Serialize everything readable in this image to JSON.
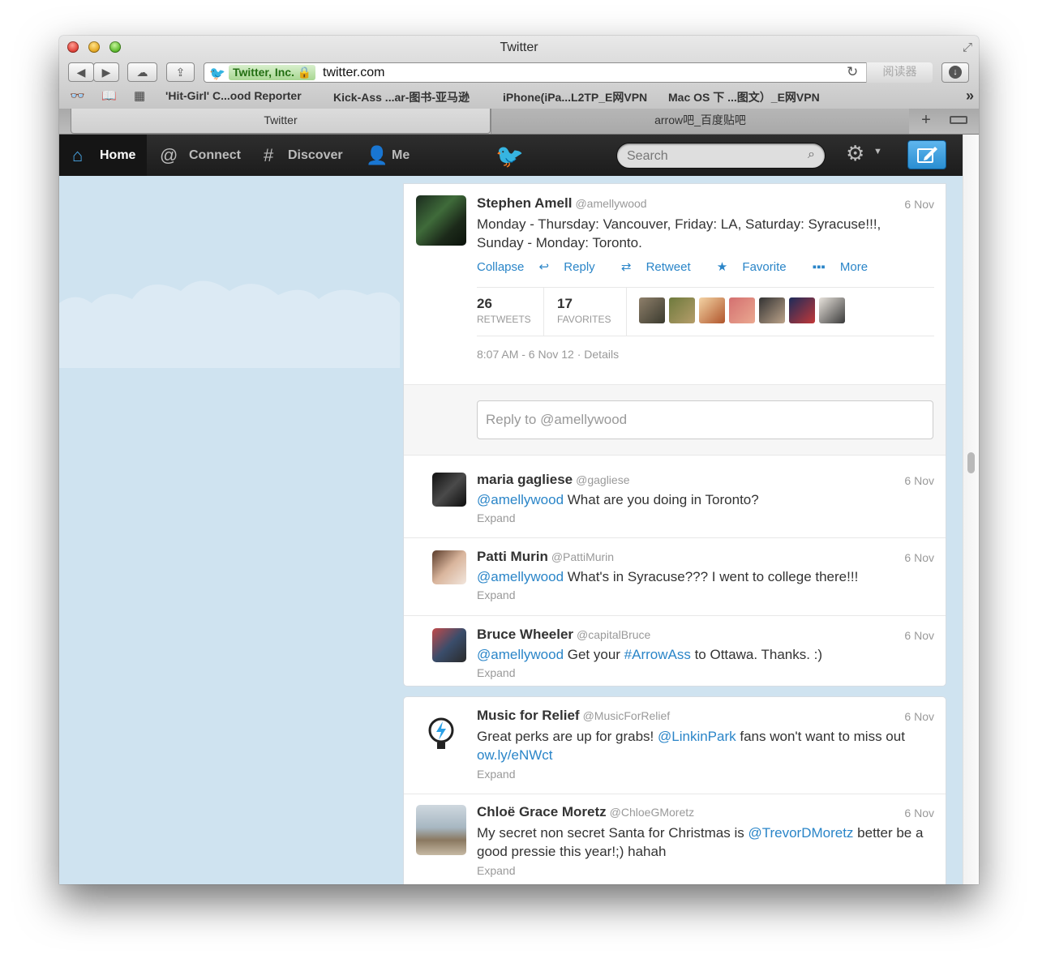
{
  "window": {
    "title": "Twitter"
  },
  "toolbar": {
    "back_icon": "◀",
    "forward_icon": "▶",
    "ev_label": "Twitter, Inc.",
    "url": "twitter.com",
    "reload_icon": "↻",
    "reader_label": "阅读器"
  },
  "bookmarks": [
    "'Hit-Girl' C...ood Reporter",
    "Kick-Ass ...ar-图书-亚马逊",
    "iPhone(iPa...L2TP_E网VPN",
    "Mac OS 下 ...图文）_E网VPN"
  ],
  "tabs": [
    "Twitter",
    "arrow吧_百度贴吧"
  ],
  "nav": {
    "home": "Home",
    "connect": "Connect",
    "discover": "Discover",
    "me": "Me",
    "search_placeholder": "Search"
  },
  "main_tweet": {
    "name": "Stephen Amell",
    "handle": "@amellywood",
    "time": "6 Nov",
    "text": "Monday - Thursday: Vancouver, Friday: LA, Saturday: Syracuse!!!, Sunday - Monday: Toronto.",
    "actions": {
      "collapse": "Collapse",
      "reply": "Reply",
      "retweet": "Retweet",
      "favorite": "Favorite",
      "more": "More"
    },
    "retweets_count": "26",
    "retweets_label": "RETWEETS",
    "favorites_count": "17",
    "favorites_label": "FAVORITES",
    "timestamp": "8:07 AM - 6 Nov 12 · Details",
    "reply_placeholder": "Reply to @amellywood"
  },
  "replies": [
    {
      "name": "maria gagliese",
      "handle": "@gagliese",
      "time": "6 Nov",
      "mention": "@amellywood",
      "text": " What are you doing in Toronto?",
      "expand": "Expand"
    },
    {
      "name": "Patti Murin",
      "handle": "@PattiMurin",
      "time": "6 Nov",
      "mention": "@amellywood",
      "text": " What's in Syracuse??? I went to college there!!!",
      "expand": "Expand"
    },
    {
      "name": "Bruce Wheeler",
      "handle": "@capitalBruce",
      "time": "6 Nov",
      "mention": "@amellywood",
      "text_a": " Get your ",
      "hashtag": "#ArrowAss",
      "text_b": " to Ottawa. Thanks. :)",
      "expand": "Expand"
    }
  ],
  "timeline": [
    {
      "name": "Music for Relief",
      "handle": "@MusicForRelief",
      "time": "6 Nov",
      "text_a": "Great perks are up for grabs! ",
      "mention": "@LinkinPark",
      "text_b": " fans won't want to miss out ",
      "link": "ow.ly/eNWct",
      "expand": "Expand"
    },
    {
      "name": "Chloë Grace Moretz",
      "handle": "@ChloeGMoretz",
      "time": "6 Nov",
      "text_a": "My secret non secret Santa for Christmas is ",
      "mention": "@TrevorDMoretz",
      "text_b": " better be a good pressie this year!;) hahah",
      "expand": "Expand"
    }
  ],
  "colors": {
    "link": "#2a85c8",
    "topbar": "#222222",
    "background": "#cfe3f0",
    "compose": "#2a8ed1"
  }
}
